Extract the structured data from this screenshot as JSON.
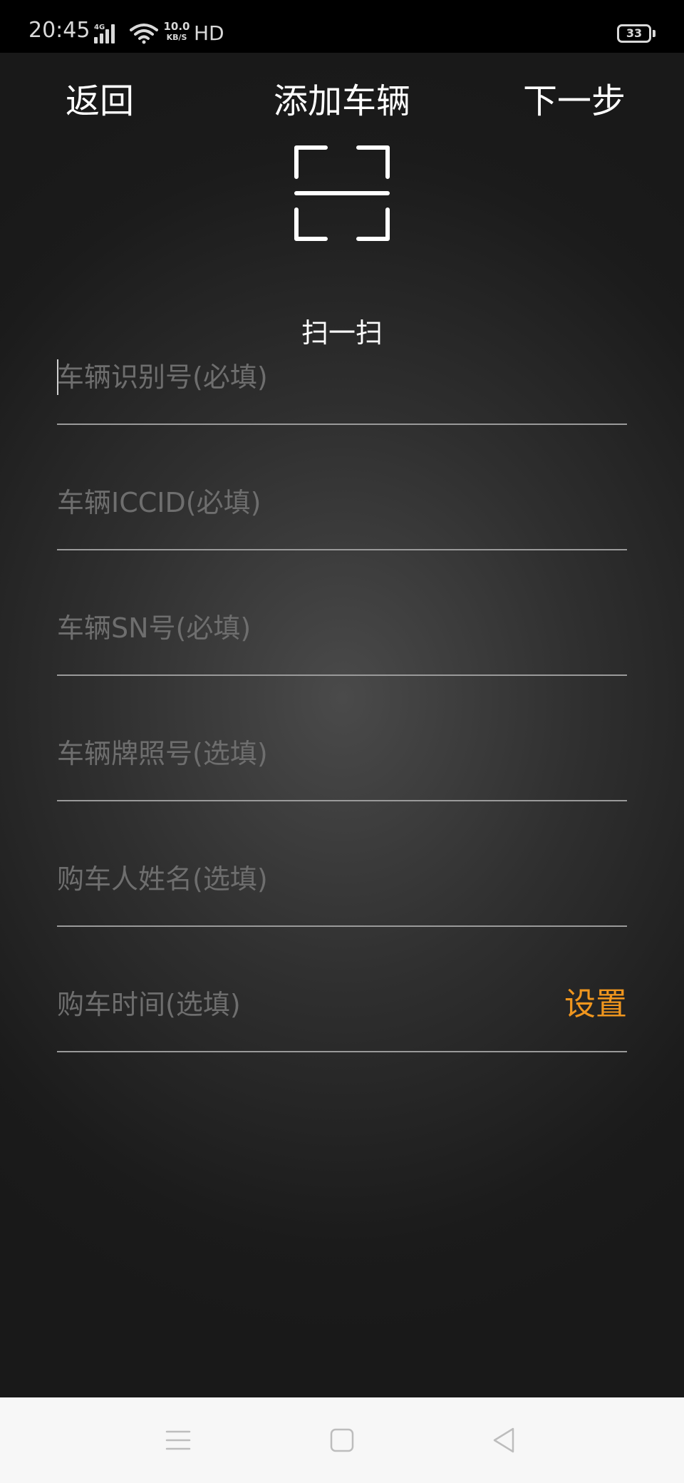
{
  "status_bar": {
    "time": "20:45",
    "network_type": "4G",
    "speed_value": "10.0",
    "speed_unit": "KB/S",
    "hd_label": "HD",
    "battery_level": "33",
    "signal_icon": "signal-bars-icon",
    "wifi_icon": "wifi-icon"
  },
  "header": {
    "back_label": "返回",
    "title": "添加车辆",
    "next_label": "下一步"
  },
  "scan": {
    "icon": "scan-frame-icon",
    "label": "扫一扫"
  },
  "form": {
    "fields": [
      {
        "placeholder": "车辆识别号(必填)",
        "value": ""
      },
      {
        "placeholder": "车辆ICCID(必填)",
        "value": ""
      },
      {
        "placeholder": "车辆SN号(必填)",
        "value": ""
      },
      {
        "placeholder": "车辆牌照号(选填)",
        "value": ""
      },
      {
        "placeholder": "购车人姓名(选填)",
        "value": ""
      },
      {
        "placeholder": "购车时间(选填)",
        "value": "",
        "action_label": "设置"
      }
    ]
  },
  "navigation_bar": {
    "menu_icon": "menu-lines-icon",
    "home_icon": "home-square-icon",
    "back_icon": "back-triangle-icon"
  },
  "colors": {
    "accent": "#f0961e",
    "placeholder": "#6e6e6e",
    "divider": "#9a9a9a",
    "background": "#2f2f2f"
  }
}
